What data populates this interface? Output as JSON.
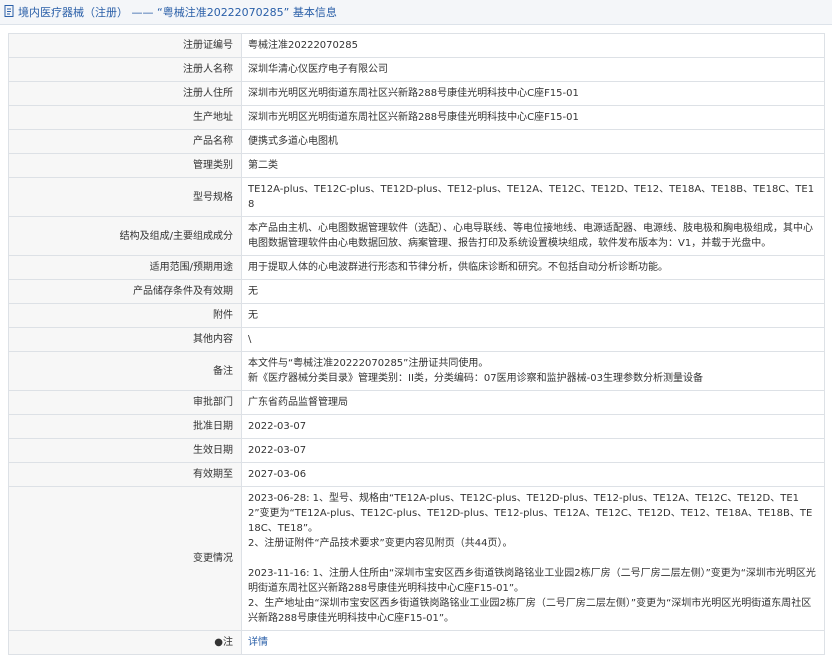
{
  "header": {
    "icon": "document-icon",
    "title": "境内医疗器械（注册） —— “粤械注准20222070285” 基本信息"
  },
  "rows": [
    {
      "label": "注册证编号",
      "value": "粤械注准20222070285"
    },
    {
      "label": "注册人名称",
      "value": "深圳华清心仪医疗电子有限公司"
    },
    {
      "label": "注册人住所",
      "value": "深圳市光明区光明街道东周社区兴新路288号康佳光明科技中心C座F15-01"
    },
    {
      "label": "生产地址",
      "value": "深圳市光明区光明街道东周社区兴新路288号康佳光明科技中心C座F15-01"
    },
    {
      "label": "产品名称",
      "value": "便携式多道心电图机"
    },
    {
      "label": "管理类别",
      "value": "第二类"
    },
    {
      "label": "型号规格",
      "value": "TE12A-plus、TE12C-plus、TE12D-plus、TE12-plus、TE12A、TE12C、TE12D、TE12、TE18A、TE18B、TE18C、TE18"
    },
    {
      "label": "结构及组成/主要组成成分",
      "value": "本产品由主机、心电图数据管理软件（选配）、心电导联线、等电位接地线、电源适配器、电源线、肢电极和胸电极组成，其中心电图数据管理软件由心电数据回放、病案管理、报告打印及系统设置模块组成，软件发布版本为：V1，并载于光盘中。"
    },
    {
      "label": "适用范围/预期用途",
      "value": "用于提取人体的心电波群进行形态和节律分析，供临床诊断和研究。不包括自动分析诊断功能。"
    },
    {
      "label": "产品储存条件及有效期",
      "value": "无"
    },
    {
      "label": "附件",
      "value": "无"
    },
    {
      "label": "其他内容",
      "value": "\\"
    },
    {
      "label": "备注",
      "lines": [
        "本文件与“粤械注准20222070285”注册证共同使用。",
        "新《医疗器械分类目录》管理类别：II类，分类编码：07医用诊察和监护器械-03生理参数分析测量设备"
      ]
    },
    {
      "label": "审批部门",
      "value": "广东省药品监督管理局"
    },
    {
      "label": "批准日期",
      "value": "2022-03-07"
    },
    {
      "label": "生效日期",
      "value": "2022-03-07"
    },
    {
      "label": "有效期至",
      "value": "2027-03-06"
    }
  ],
  "changes": {
    "label": "变更情况",
    "p1_line1": "2023-06-28: 1、型号、规格由“TE12A-plus、TE12C-plus、TE12D-plus、TE12-plus、TE12A、TE12C、TE12D、TE12”变更为“TE12A-plus、TE12C-plus、TE12D-plus、TE12-plus、TE12A、TE12C、TE12D、TE12、TE18A、TE18B、TE18C、TE18”。",
    "p1_line2": "2、注册证附件“产品技术要求”变更内容见附页（共44页）。",
    "p2_line1": "2023-11-16: 1、注册人住所由“深圳市宝安区西乡街道铁岗路铭业工业园2栋厂房（二号厂房二层左侧）”变更为“深圳市光明区光明街道东周社区兴新路288号康佳光明科技中心C座F15-01”。",
    "p2_line2": "2、生产地址由“深圳市宝安区西乡街道铁岗路铭业工业园2栋厂房（二号厂房二层左侧）”变更为“深圳市光明区光明街道东周社区兴新路288号康佳光明科技中心C座F15-01”。"
  },
  "footer": {
    "label_icon": "bullet-icon",
    "label": "注",
    "link": "详情"
  }
}
